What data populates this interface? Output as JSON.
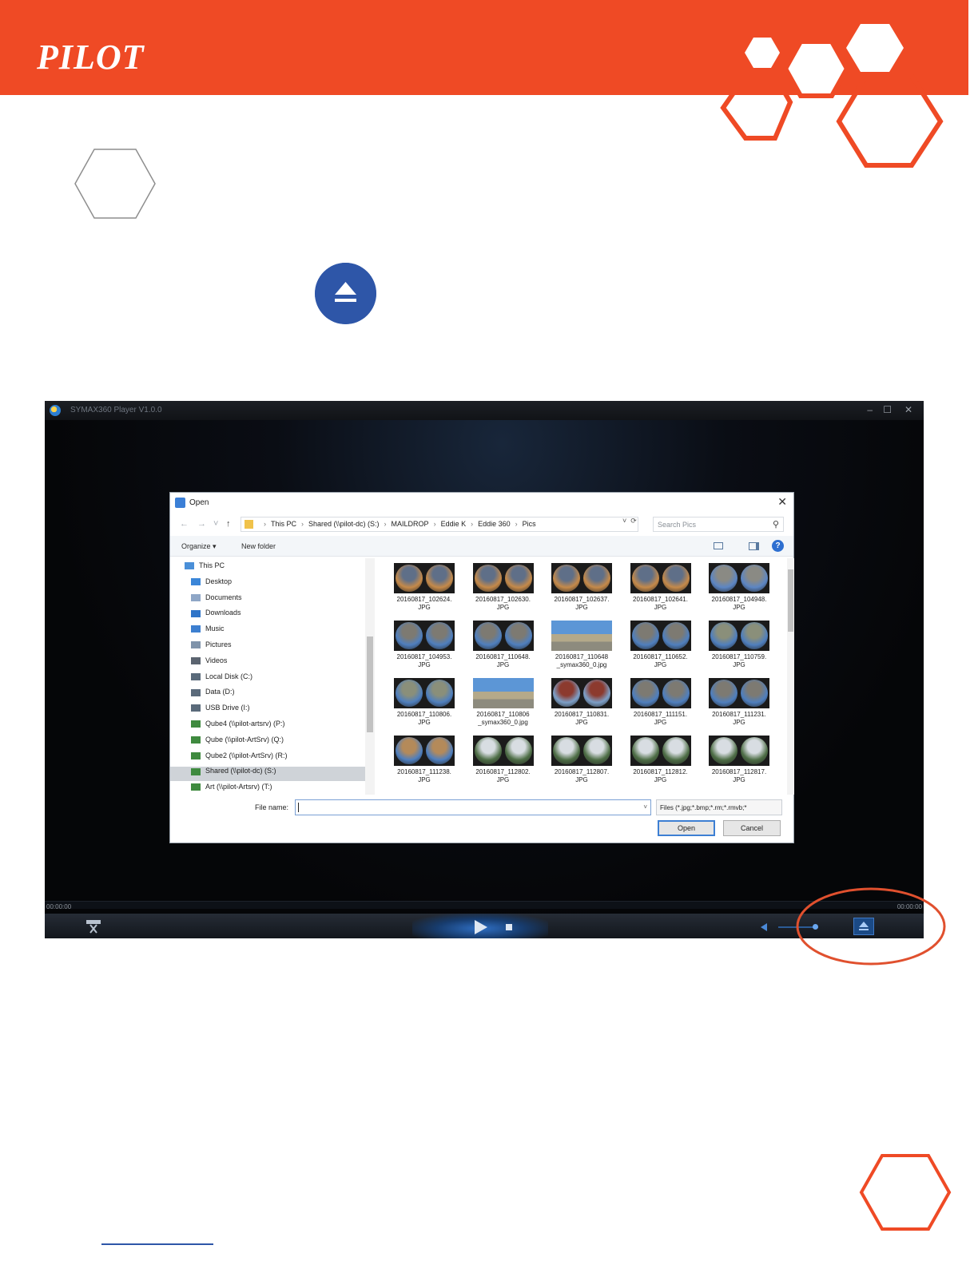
{
  "brand": {
    "logo_text": "PILOT",
    "accent": "#ef4a25",
    "blue": "#2e56a8"
  },
  "player": {
    "title": "SYMAX360 Player V1.0.0",
    "time_left": "00:00:00",
    "time_right": "00:00:00"
  },
  "dialog": {
    "title": "Open",
    "breadcrumbs": [
      "This PC",
      "Shared (\\\\pilot-dc) (S:)",
      "MAILDROP",
      "Eddie K",
      "Eddie 360",
      "Pics"
    ],
    "search_placeholder": "Search Pics",
    "toolbar": {
      "organize": "Organize ▾",
      "new_folder": "New folder"
    },
    "nav_items": [
      {
        "label": "This PC",
        "icon": "computer-icon",
        "color": "#4a8fd8"
      },
      {
        "label": "Desktop",
        "icon": "desktop-icon",
        "color": "#3b86d8"
      },
      {
        "label": "Documents",
        "icon": "documents-icon",
        "color": "#8ea6c6"
      },
      {
        "label": "Downloads",
        "icon": "download-icon",
        "color": "#2f74c8"
      },
      {
        "label": "Music",
        "icon": "music-icon",
        "color": "#3d7fd0"
      },
      {
        "label": "Pictures",
        "icon": "pictures-icon",
        "color": "#7f93aa"
      },
      {
        "label": "Videos",
        "icon": "videos-icon",
        "color": "#5b6470"
      },
      {
        "label": "Local Disk (C:)",
        "icon": "drive-icon",
        "color": "#5a6a7a"
      },
      {
        "label": "Data (D:)",
        "icon": "drive-icon",
        "color": "#5a6a7a"
      },
      {
        "label": "USB Drive (I:)",
        "icon": "drive-icon",
        "color": "#5a6a7a"
      },
      {
        "label": "Qube4 (\\\\pilot-artsrv) (P:)",
        "icon": "network-drive-icon",
        "color": "#3f8a3f"
      },
      {
        "label": "Qube (\\\\pilot-ArtSrv) (Q:)",
        "icon": "network-drive-icon",
        "color": "#3f8a3f"
      },
      {
        "label": "Qube2 (\\\\pilot-ArtSrv) (R:)",
        "icon": "network-drive-icon",
        "color": "#3f8a3f"
      },
      {
        "label": "Shared (\\\\pilot-dc) (S:)",
        "icon": "network-drive-icon",
        "color": "#3f8a3f",
        "selected": true
      },
      {
        "label": "Art (\\\\pilot-Artsrv) (T:)",
        "icon": "network-drive-icon",
        "color": "#3f8a3f"
      }
    ],
    "files": [
      {
        "l1": "20160817_102624.",
        "l2": "JPG",
        "kind": "fish",
        "a": "#c58a4a",
        "b": "#5f6f88"
      },
      {
        "l1": "20160817_102630.",
        "l2": "JPG",
        "kind": "fish",
        "a": "#c58a4a",
        "b": "#5f6f88"
      },
      {
        "l1": "20160817_102637.",
        "l2": "JPG",
        "kind": "fish",
        "a": "#c58a4a",
        "b": "#5f6f88"
      },
      {
        "l1": "20160817_102641.",
        "l2": "JPG",
        "kind": "fish",
        "a": "#c58a4a",
        "b": "#5f6f88"
      },
      {
        "l1": "20160817_104948.",
        "l2": "JPG",
        "kind": "fish",
        "a": "#5c86c4",
        "b": "#8a8a84"
      },
      {
        "l1": "20160817_104953.",
        "l2": "JPG",
        "kind": "fish",
        "a": "#4f7fbe",
        "b": "#7d7a72"
      },
      {
        "l1": "20160817_110648.",
        "l2": "JPG",
        "kind": "fish",
        "a": "#4f7fbe",
        "b": "#7d7a72"
      },
      {
        "l1": "20160817_110648",
        "l2": "_symax360_0.jpg",
        "kind": "pano"
      },
      {
        "l1": "20160817_110652.",
        "l2": "JPG",
        "kind": "fish",
        "a": "#4f7fbe",
        "b": "#7d7a72"
      },
      {
        "l1": "20160817_110759.",
        "l2": "JPG",
        "kind": "fish",
        "a": "#4f7fbe",
        "b": "#8a8f7a"
      },
      {
        "l1": "20160817_110806.",
        "l2": "JPG",
        "kind": "fish",
        "a": "#4f7fbe",
        "b": "#8a8f7a"
      },
      {
        "l1": "20160817_110806",
        "l2": "_symax360_0.jpg",
        "kind": "pano"
      },
      {
        "l1": "20160817_110831.",
        "l2": "JPG",
        "kind": "fish",
        "a": "#7da0c8",
        "b": "#8c3a2e"
      },
      {
        "l1": "20160817_111151.",
        "l2": "JPG",
        "kind": "fish",
        "a": "#4f7fbe",
        "b": "#7d7a72"
      },
      {
        "l1": "20160817_111231.",
        "l2": "JPG",
        "kind": "fish",
        "a": "#4f7fbe",
        "b": "#7d7a72"
      },
      {
        "l1": "20160817_111238.",
        "l2": "JPG",
        "kind": "fish",
        "a": "#4f7fbe",
        "b": "#b48a5a"
      },
      {
        "l1": "20160817_112802.",
        "l2": "JPG",
        "kind": "fish",
        "a": "#4e6e46",
        "b": "#d8dde2"
      },
      {
        "l1": "20160817_112807.",
        "l2": "JPG",
        "kind": "fish",
        "a": "#4e6e46",
        "b": "#d8dde2"
      },
      {
        "l1": "20160817_112812.",
        "l2": "JPG",
        "kind": "fish",
        "a": "#4e6e46",
        "b": "#d8dde2"
      },
      {
        "l1": "20160817_112817.",
        "l2": "JPG",
        "kind": "fish",
        "a": "#4e6e46",
        "b": "#d8dde2"
      }
    ],
    "file_name_label": "File name:",
    "file_name_value": "",
    "filter": "Files (*.jpg;*.bmp;*.rm;*.rmvb;*",
    "open_label": "Open",
    "cancel_label": "Cancel"
  }
}
